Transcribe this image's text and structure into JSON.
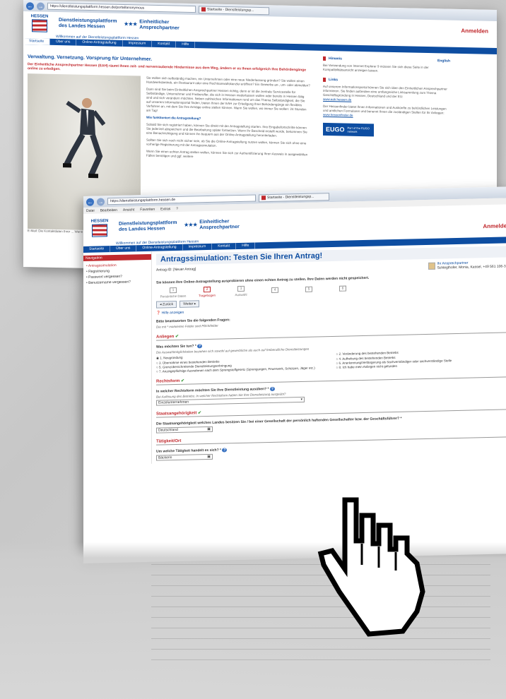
{
  "win1": {
    "url": "https://dienstleistungsplattform.hessen.de/portal/anonymous",
    "tab": "Startseite - Dienstleistungsp...",
    "logo": "HESSEN",
    "portal": [
      "Dienstleistungsplattform",
      "des Landes Hessen"
    ],
    "eap": [
      "Einheitlicher",
      "Ansprechpartner"
    ],
    "login": "Anmelden",
    "welcome": "Willkommen auf der Dienstleistungsplattform Hessen",
    "nav": [
      "Startseite",
      "Über uns",
      "Online-Antragstellung",
      "Impressum",
      "Kontakt",
      "Hilfe"
    ],
    "headline": "Verwaltung. Vernetzung. Vorsprung für Unternehmer.",
    "lead": "Der Einheitliche Ansprechpartner Hessen (EAH) räumt Ihnen zeit- und nervenraubende Hindernisse aus dem Weg, ändern er es Ihnen erfolgreich Ihre Behördengänge online zu erledigen.",
    "p1": "Sie wollen sich selbständig machen, ein Unternehmen oder eine neue Niederlassung gründen? Sie wollen einen Handwerksbetrieb, ein Restaurant oder eine Rechtsanwaltskanzlei eröffnen? Ein Gewerbe an-, um- oder abmelden?",
    "p2": "Dann sind Sie beim Einheitlichen Ansprechpartner Hessen richtig, denn er ist die zentrale Servicestelle für Selbständige, Unternehmer und Freiberufler, die sich in Hessen niederlassen wollen oder bereits in Hessen tätig sind und sich verändern möchten. Neben zahlreichen Informationen rund um das Thema Selbständigkeit, die Sie auf unserem Informationsportal finden, bieten Ihnen der EAH zur Erledigung Ihrer Behördengänge ein flexibles Verfahren an, mit dem Sie Ihre Anträge online stellen können. Wann Sie wollen, wo immer Sie wollen: 24 Stunden am Tag!",
    "h2": "Wie funktioniert die Antragstellung?",
    "p3": "Sobald Sie sich registriert haben, können Sie direkt mit der Antragstellung starten. Ihre Eingabefortschritte können Sie jederzeit abspeichern und die Bearbeitung später fortsetzen. Wenn Ihr Bescheid erstellt wurde, bekommen Sie eine Benachrichtigung und können ihn bequem aus der Online-Antragstellung herunterladen.",
    "p4": "Sollten Sie sich noch nicht sicher sein, ob Sie die Online-Antragstellung nutzen wollen, können Sie sich ohne eine vorherige Registrierung mit der Antragssimulation.",
    "p5": "Wenn Sie einen echten Antrag stellen wollen, können Sie sich zur Authentifizierung Ihren Ausweis in ausgewählten Fällen benötigen und ggf. weitere",
    "caption": "E-Mail: Die Kontaktdaten Ihrer ... Wenn Sie Ihren Antrag nicht ... Ansprechpartner wenden.",
    "side": {
      "h_hinweis": "Hinweis",
      "english": "English",
      "hinweis": "Bei Verwendung von Internet Explorer 9 müssen Sie sich diese Seite in der Kompatibilitätsansicht anzeigen lassen.",
      "h_links": "Links",
      "links": "Auf unserem Informationsportal können Sie sich über den Einheitlichen Ansprechpartner informieren. Sie finden außerdem eine umfangreiche Linksammlung zum Thema Geschäftsgründung in Hessen, Deutschland und der EU:",
      "link1": "www.eah.hessen.de",
      "p2": "Der Hessenfinder bietet Ihnen Informationen und Auskünfte zu behördlichen Leistungen und amtlichen Formularen und benennt Ihnen die zuständigen Stellen für Ihr Anliegen:",
      "link2": "www.hessenfinder.de",
      "eugo": "EUGO",
      "eugo_sub": "Part of the EUGO network"
    }
  },
  "win2": {
    "url": "https://dienstleistungsplattform.hessen.de",
    "tab": "Startseite - Dienstleistungsp...",
    "menu": [
      "Datei",
      "Bearbeiten",
      "Ansicht",
      "Favoriten",
      "Extras",
      "?"
    ],
    "side": {
      "title": "Navigation",
      "items": [
        "Antragssimulation",
        "Registrierung",
        "Passwort vergessen?",
        "Benutzername vergessen?"
      ]
    },
    "page_title": "Antragssimulation: Testen Sie Ihren Antrag!",
    "antrag": "Antrag-ID: [Neuer Antrag]",
    "contact_label": "Ihr Ansprechpartner",
    "contact": "Schlegthofer, Monia, Kassel, +49 561 106-3366",
    "intro": "Sie können Ihre Online-Antragstellung ausprobieren ohne einen echten Antrag zu stellen. Ihre Daten werden nicht gespeichert.",
    "steps": [
      {
        "n": "1",
        "l": "Persönliche Daten"
      },
      {
        "n": "2",
        "l": "Tragebogen"
      },
      {
        "n": "3",
        "l": "Auswahl"
      },
      {
        "n": "4",
        "l": ""
      },
      {
        "n": "5",
        "l": ""
      },
      {
        "n": "6",
        "l": ""
      }
    ],
    "btn_back": "Zurück",
    "btn_next": "Weiter",
    "help": "Hilfe anzeigen",
    "form_q": "Bitte beantworten Sie die folgenden Fragen:",
    "required": "Die mit * markierten Felder sind Pflichtfelder",
    "s1": "Anliegen",
    "q1": "Was möchten Sie tun? *",
    "h1": "Die Auswahlmöglichkeiten beziehen sich sowohl auf gewerbliche als auch auf freiberufliche Dienstleistungen",
    "opts": [
      "1. Neugründung",
      "2. Veränderung des bestehenden Betriebs",
      "3. Übernahme eines bestehenden Betriebs",
      "4. Aufhebung des bestehenden Betriebs",
      "5. Grenzüberschreitende Dienstleistungserbringung",
      "6. Anerkennung/Verlängerung als Sachverständiger oder sachverständige Stelle",
      "7. Anzeigepflichtige Ausnahmen nach dem Sprengstoffgesetz (Sprengungen, Feuerwerk, Schützen, Jäger etc.)",
      "8. Ich habe mein Anliegen nicht gefunden"
    ],
    "s2": "Rechtsform",
    "q2": "In welcher Rechtsform möchten Sie Ihre Dienstleistung ausüben? *",
    "h2": "Bei Auflösung des Betriebs: In welcher Rechtsform haben Sie Ihre Dienstleistung ausgeübt?",
    "v2": "Einzelunternehmen",
    "s3": "Staatsangehörigkeit",
    "q3": "Die Staatsangehörigkeit welches Landes besitzen Sie / bei einer Gesellschaft der persönlich haftenden Gesellschafter bzw. der Geschäftsführer? *",
    "v3": "Deutschland",
    "s4": "Tätigkeit/Ort",
    "q4": "Um welche Tätigkeit handelt es sich? *",
    "v4": "Bäckerin"
  }
}
